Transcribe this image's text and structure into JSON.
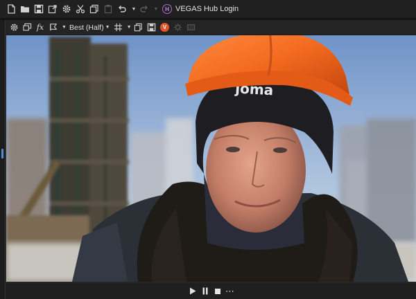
{
  "window": {
    "hub_badge": "H",
    "hub_label": "VEGAS Hub Login"
  },
  "preview_toolbar": {
    "fx_label": "fx",
    "quality": "Best (Half)",
    "vegas_badge": "V"
  },
  "transport": {
    "more_label": "⋯"
  },
  "colors": {
    "accent": "#b36ad6",
    "vegas_orange": "#e0532a",
    "focus_blue": "#4a90d9"
  }
}
